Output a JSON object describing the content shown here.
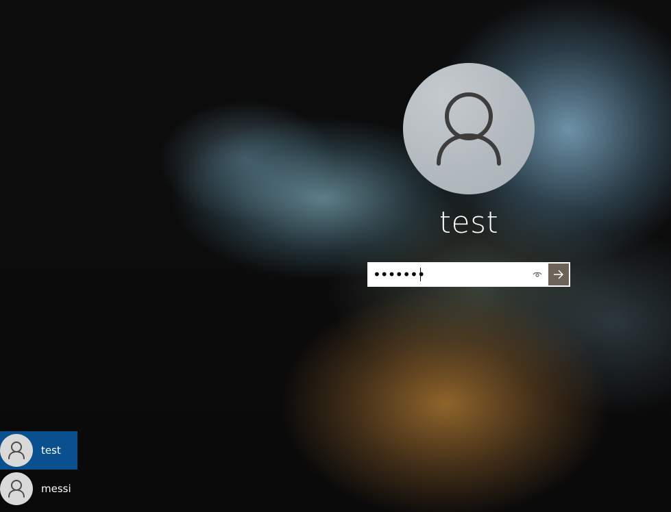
{
  "background": {
    "icon": "blurred-wallpaper"
  },
  "current_user": {
    "name": "test",
    "avatar_icon": "person-icon"
  },
  "password": {
    "value": "•••••••",
    "reveal_icon": "eye-icon",
    "submit_icon": "arrow-right-icon"
  },
  "user_list": [
    {
      "name": "test",
      "selected": true,
      "avatar_icon": "person-icon"
    },
    {
      "name": "messi",
      "selected": false,
      "avatar_icon": "person-icon"
    }
  ],
  "colors": {
    "selected_user_bg": "#0a4f8e",
    "submit_button_bg": "#6c6258"
  }
}
